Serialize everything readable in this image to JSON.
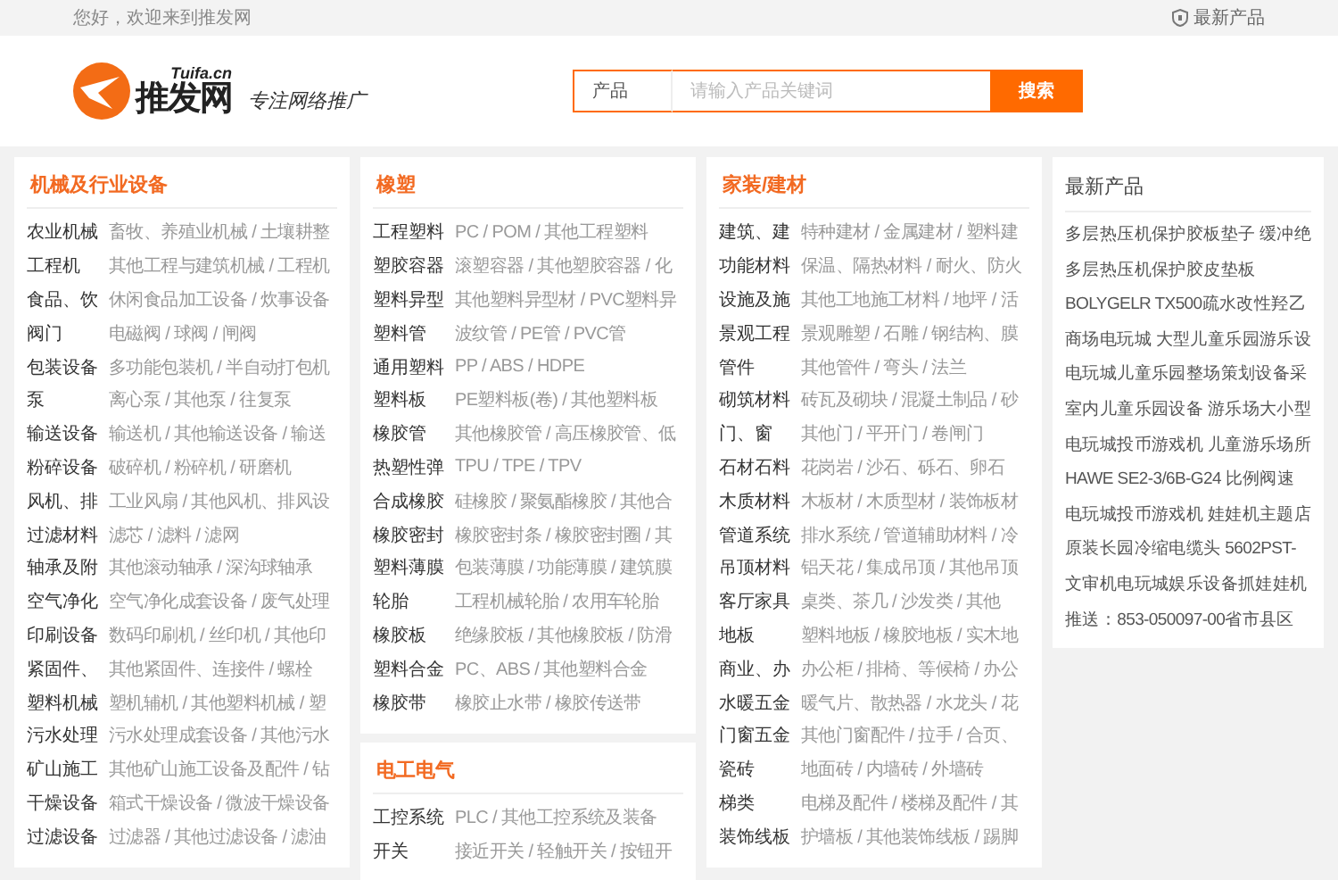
{
  "top_bar": {
    "greeting": "您好，欢迎来到推发网",
    "link": "最新产品"
  },
  "header": {
    "logo": {
      "domain": "Tuifa.cn",
      "name": "推发网"
    },
    "slogan": "专注网络推广",
    "search": {
      "category": "产品",
      "placeholder": "请输入产品关键词",
      "button": "搜索"
    }
  },
  "categories": [
    {
      "title": "机械及行业设备",
      "rows": [
        {
          "label": "农业机械",
          "links": "畜牧、养殖业机械 / 土壤耕整"
        },
        {
          "label": "工程机",
          "links": "其他工程与建筑机械 / 工程机"
        },
        {
          "label": "食品、饮",
          "links": "休闲食品加工设备 / 炊事设备"
        },
        {
          "label": "阀门",
          "links": "电磁阀 / 球阀 / 闸阀"
        },
        {
          "label": "包装设备",
          "links": "多功能包装机 / 半自动打包机"
        },
        {
          "label": "泵",
          "links": "离心泵 / 其他泵 / 往复泵"
        },
        {
          "label": "输送设备",
          "links": "输送机 / 其他输送设备 / 输送"
        },
        {
          "label": "粉碎设备",
          "links": "破碎机 / 粉碎机 / 研磨机"
        },
        {
          "label": "风机、排",
          "links": "工业风扇 / 其他风机、排风设"
        },
        {
          "label": "过滤材料",
          "links": "滤芯 / 滤料 / 滤网"
        },
        {
          "label": "轴承及附",
          "links": "其他滚动轴承 / 深沟球轴承"
        },
        {
          "label": "空气净化",
          "links": "空气净化成套设备 / 废气处理"
        },
        {
          "label": "印刷设备",
          "links": "数码印刷机 / 丝印机 / 其他印"
        },
        {
          "label": "紧固件、",
          "links": "其他紧固件、连接件 / 螺栓"
        },
        {
          "label": "塑料机械",
          "links": "塑机辅机 / 其他塑料机械 / 塑"
        },
        {
          "label": "污水处理",
          "links": "污水处理成套设备 / 其他污水"
        },
        {
          "label": "矿山施工",
          "links": "其他矿山施工设备及配件 / 钻"
        },
        {
          "label": "干燥设备",
          "links": "箱式干燥设备 / 微波干燥设备"
        },
        {
          "label": "过滤设备",
          "links": "过滤器 / 其他过滤设备 / 滤油"
        }
      ]
    },
    {
      "title": "橡塑",
      "rows": [
        {
          "label": "工程塑料",
          "links": "PC / POM / 其他工程塑料"
        },
        {
          "label": "塑胶容器",
          "links": "滚塑容器 / 其他塑胶容器 / 化"
        },
        {
          "label": "塑料异型",
          "links": "其他塑料异型材 / PVC塑料异"
        },
        {
          "label": "塑料管",
          "links": "波纹管 / PE管 / PVC管"
        },
        {
          "label": "通用塑料",
          "links": "PP / ABS / HDPE"
        },
        {
          "label": "塑料板",
          "links": "PE塑料板(卷) / 其他塑料板"
        },
        {
          "label": "橡胶管",
          "links": "其他橡胶管 / 高压橡胶管、低"
        },
        {
          "label": "热塑性弹",
          "links": "TPU / TPE / TPV"
        },
        {
          "label": "合成橡胶",
          "links": "硅橡胶 / 聚氨酯橡胶 / 其他合"
        },
        {
          "label": "橡胶密封",
          "links": "橡胶密封条 / 橡胶密封圈 / 其"
        },
        {
          "label": "塑料薄膜",
          "links": "包装薄膜 / 功能薄膜 / 建筑膜"
        },
        {
          "label": "轮胎",
          "links": "工程机械轮胎 / 农用车轮胎"
        },
        {
          "label": "橡胶板",
          "links": "绝缘胶板 / 其他橡胶板 / 防滑"
        },
        {
          "label": "塑料合金",
          "links": "PC、ABS / 其他塑料合金"
        },
        {
          "label": "橡胶带",
          "links": "橡胶止水带 / 橡胶传送带"
        }
      ]
    },
    {
      "title": "电工电气",
      "rows": [
        {
          "label": "工控系统",
          "links": "PLC / 其他工控系统及装备"
        },
        {
          "label": "开关",
          "links": "接近开关 / 轻触开关 / 按钮开"
        }
      ]
    },
    {
      "title": "家装/建材",
      "rows": [
        {
          "label": "建筑、建",
          "links": "特种建材 / 金属建材 / 塑料建"
        },
        {
          "label": "功能材料",
          "links": "保温、隔热材料 / 耐火、防火"
        },
        {
          "label": "设施及施",
          "links": "其他工地施工材料 / 地坪 / 活"
        },
        {
          "label": "景观工程",
          "links": "景观雕塑 / 石雕 / 钢结构、膜"
        },
        {
          "label": "管件",
          "links": "其他管件 / 弯头 / 法兰"
        },
        {
          "label": "砌筑材料",
          "links": "砖瓦及砌块 / 混凝土制品 / 砂"
        },
        {
          "label": "门、窗",
          "links": "其他门 / 平开门 / 卷闸门"
        },
        {
          "label": "石材石料",
          "links": "花岗岩 / 沙石、砾石、卵石"
        },
        {
          "label": "木质材料",
          "links": "木板材 / 木质型材 / 装饰板材"
        },
        {
          "label": "管道系统",
          "links": "排水系统 / 管道辅助材料 / 冷"
        },
        {
          "label": "吊顶材料",
          "links": "铝天花 / 集成吊顶 / 其他吊顶"
        },
        {
          "label": "客厅家具",
          "links": "桌类、茶几 / 沙发类 / 其他"
        },
        {
          "label": "地板",
          "links": "塑料地板 / 橡胶地板 / 实木地"
        },
        {
          "label": "商业、办",
          "links": "办公柜 / 排椅、等候椅 / 办公"
        },
        {
          "label": "水暖五金",
          "links": "暖气片、散热器 / 水龙头 / 花"
        },
        {
          "label": "门窗五金",
          "links": "其他门窗配件 / 拉手 / 合页、"
        },
        {
          "label": "瓷砖",
          "links": "地面砖 / 内墙砖 / 外墙砖"
        },
        {
          "label": "梯类",
          "links": "电梯及配件 / 楼梯及配件 / 其"
        },
        {
          "label": "装饰线板",
          "links": "护墙板 / 其他装饰线板 / 踢脚"
        }
      ]
    }
  ],
  "latest": {
    "title": "最新产品",
    "items": [
      "多层热压机保护胶板垫子 缓冲绝",
      "多层热压机保护胶皮垫板",
      "BOLYGELR TX500疏水改性羟乙",
      "商场电玩城 大型儿童乐园游乐设",
      "电玩城儿童乐园整场策划设备采",
      "室内儿童乐园设备 游乐场大小型",
      "电玩城投币游戏机 儿童游乐场所",
      "HAWE SE2-3/6B-G24 比例阀速",
      "电玩城投币游戏机 娃娃机主题店",
      "原装长园冷缩电缆头 5602PST-",
      "文审机电玩城娱乐设备抓娃娃机",
      "推送：853-050097-00省市县区"
    ]
  }
}
